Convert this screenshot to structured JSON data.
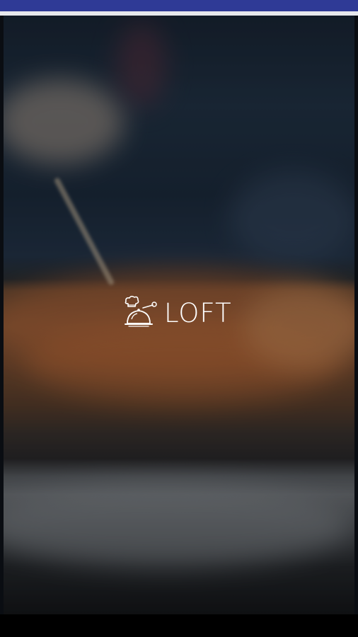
{
  "status_bar": {
    "color": "#2f3a96"
  },
  "splash": {
    "logo": {
      "text": "LOFT",
      "icon": "chef-cloche-icon"
    }
  }
}
